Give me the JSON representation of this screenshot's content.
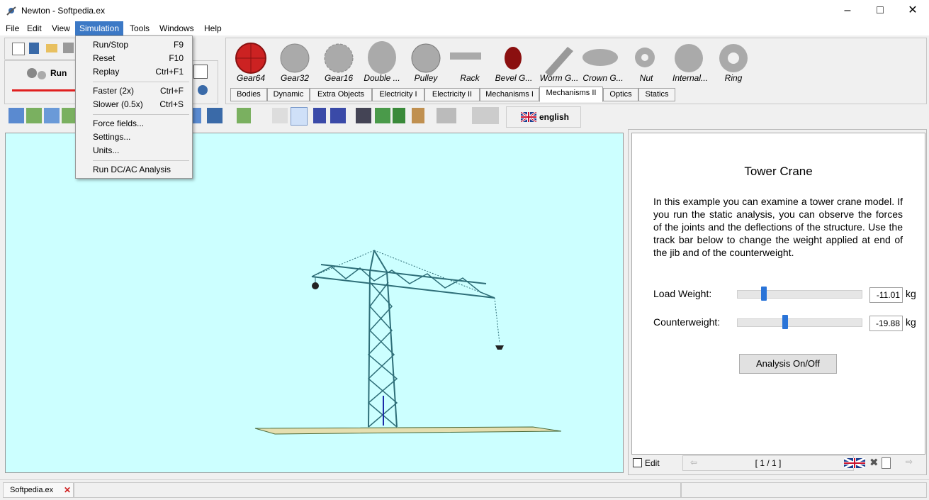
{
  "window": {
    "title": "Newton - Softpedia.ex"
  },
  "menubar": [
    "File",
    "Edit",
    "View",
    "Simulation",
    "Tools",
    "Windows",
    "Help"
  ],
  "simulation_menu": [
    {
      "label": "Run/Stop",
      "shortcut": "F9"
    },
    {
      "label": "Reset",
      "shortcut": "F10"
    },
    {
      "label": "Replay",
      "shortcut": "Ctrl+F1"
    },
    {
      "label": "Faster (2x)",
      "shortcut": "Ctrl+F"
    },
    {
      "label": "Slower (0.5x)",
      "shortcut": "Ctrl+S"
    },
    {
      "label": "Force fields...",
      "shortcut": ""
    },
    {
      "label": "Settings...",
      "shortcut": ""
    },
    {
      "label": "Units...",
      "shortcut": ""
    },
    {
      "label": "Run DC/AC Analysis",
      "shortcut": ""
    }
  ],
  "run_label": "Run",
  "palette": {
    "items": [
      "Gear64",
      "Gear32",
      "Gear16",
      "Double ...",
      "Pulley",
      "Rack",
      "Bevel G...",
      "Worm G...",
      "Crown G...",
      "Nut",
      "Internal...",
      "Ring"
    ],
    "tabs": [
      "Bodies",
      "Dynamic",
      "Extra Objects",
      "Electricity I",
      "Electricity II",
      "Mechanisms I",
      "Mechanisms II",
      "Optics",
      "Statics"
    ],
    "selected_tab": "Mechanisms II"
  },
  "language": "english",
  "info": {
    "title": "Tower Crane",
    "description": "In this example you can examine a tower crane model. If you run the static analysis, you can observe the forces of the joints and the deflections of the structure. Use the track bar below to change the weight applied at end of the jib and of the counterweight.",
    "load_label": "Load Weight:",
    "load_value": "-11.01",
    "load_fraction": 0.2,
    "counter_label": "Counterweight:",
    "counter_value": "-19.88",
    "counter_fraction": 0.38,
    "unit": "kg",
    "analysis_button": "Analysis On/Off"
  },
  "footer": {
    "edit_label": "Edit",
    "page": "[ 1 / 1 ]"
  },
  "statusbar": {
    "tab_label": "Softpedia.ex"
  },
  "colors": {
    "viewport_bg": "#ccffff",
    "crane": "#2e6e78",
    "accent": "#3c79c6"
  }
}
